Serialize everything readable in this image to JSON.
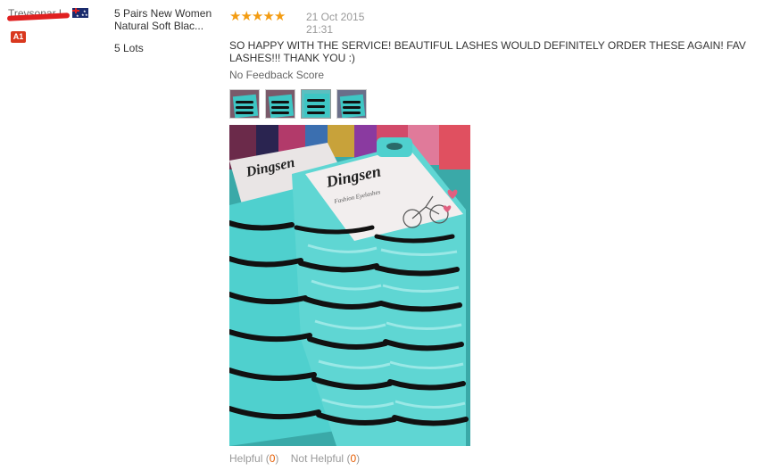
{
  "buyer": {
    "name": "Trevsonar L",
    "country_flag": "australia-flag-icon",
    "level_badge": "A1"
  },
  "product": {
    "name": "5 Pairs New Women Natural Soft Blac...",
    "quantity": "5 Lots"
  },
  "review": {
    "rating_stars": 5,
    "date": "21 Oct 2015 21:31",
    "text": "SO HAPPY WITH THE SERVICE! BEAUTIFUL LASHES WOULD DEFINITELY ORDER THESE AGAIN! FAV LASHES!!! THANK YOU :)",
    "feedback_score": "No Feedback Score",
    "photo_brand": "Dingsen",
    "photo_subtitle": "Fashion Eyelashes",
    "helpful_label": "Helpful",
    "helpful_count": "0",
    "not_helpful_label": "Not Helpful",
    "not_helpful_count": "0"
  },
  "colors": {
    "star": "#f39c12",
    "badge": "#d9381e",
    "count": "#e55c00",
    "teal": "#3ec6c4"
  }
}
